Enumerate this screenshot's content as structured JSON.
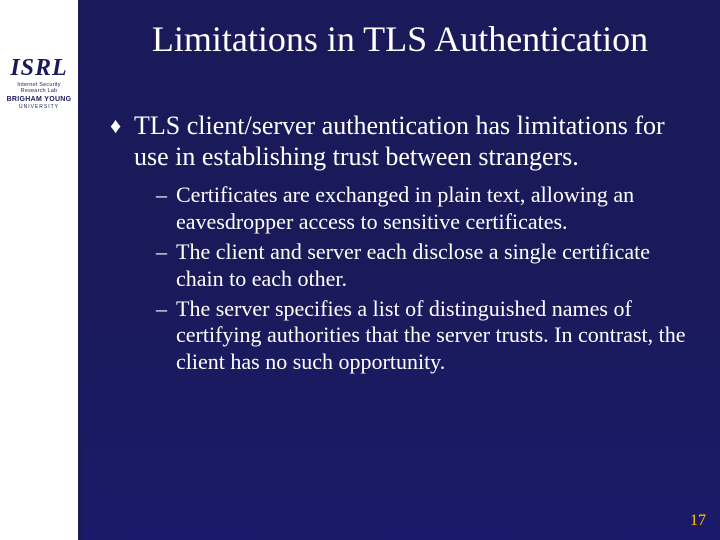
{
  "logo": {
    "main": "ISRL",
    "sub": "Internet Security Research Lab",
    "univ": "BRIGHAM YOUNG",
    "univ_sub": "UNIVERSITY"
  },
  "title": "Limitations in TLS Authentication",
  "main_bullet": "TLS client/server authentication has limitations for use in establishing trust between strangers.",
  "sub_bullets": [
    "Certificates are exchanged in plain text, allowing an eavesdropper access to sensitive certificates.",
    "The client and server each disclose a single certificate chain to each other.",
    "The server specifies a list of distinguished names of certifying authorities that the server trusts.  In contrast, the client has no such opportunity."
  ],
  "page_number": "17"
}
